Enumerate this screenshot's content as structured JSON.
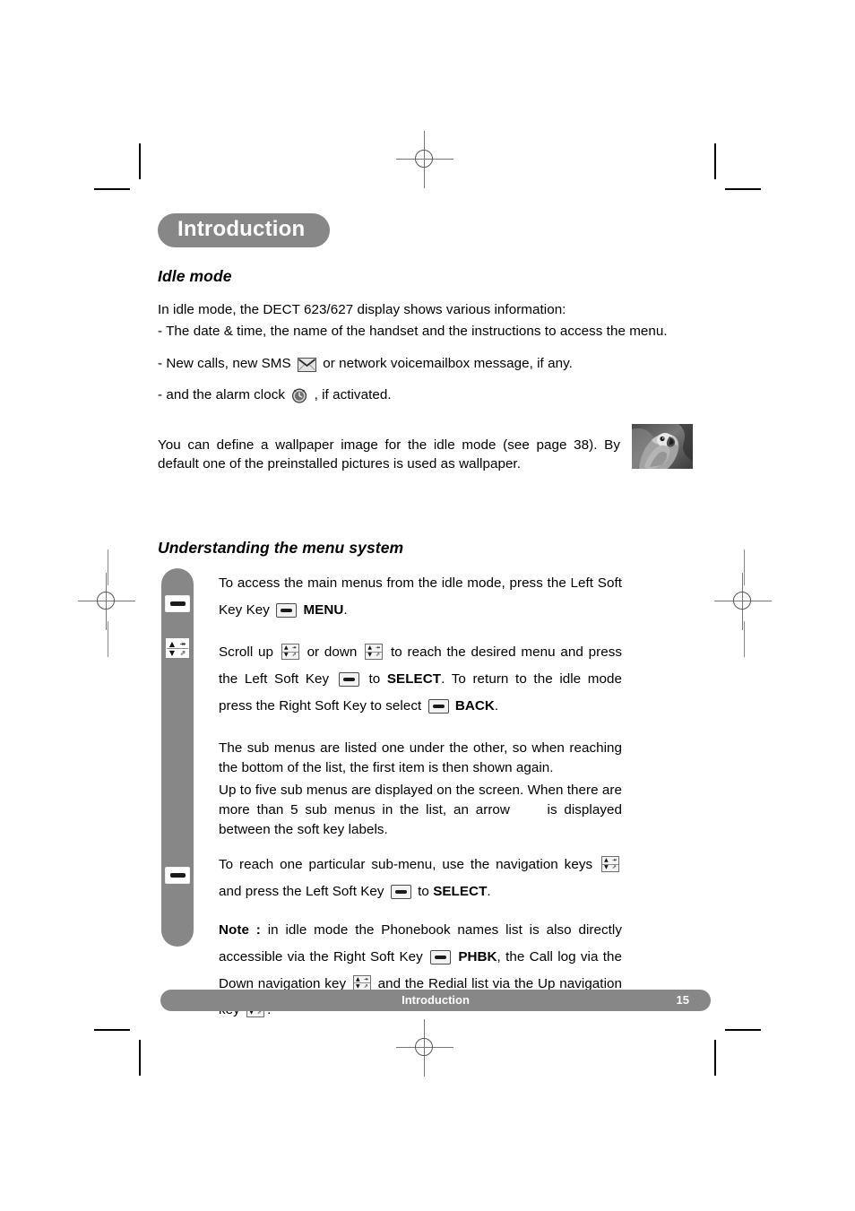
{
  "page": {
    "chapter_title": "Introduction",
    "footer_title": "Introduction",
    "page_number": "15",
    "accent_gray": "#878787"
  },
  "sections": {
    "idle_mode": {
      "heading": "Idle mode",
      "intro": "In idle mode, the DECT 623/627 display shows various information:",
      "bullet_date": "- The date & time, the name of the handset and the instructions to access the menu.",
      "bullet_sms_before": "- New calls, new SMS",
      "bullet_sms_after": "or network voicemailbox message, if any.",
      "bullet_alarm_before": "- and the alarm clock",
      "bullet_alarm_after": ", if activated.",
      "wallpaper_paragraph": "You can define a wallpaper image for the idle mode (see page 38). By default one of the preinstalled pictures is used as wallpaper.",
      "wallpaper_image_alt": "parrot-wallpaper-thumbnail"
    },
    "menu_system": {
      "heading": "Understanding the menu system",
      "p1_a": "To access the main menus from the idle mode, press the Left Soft Key",
      "p1_b": "MENU",
      "p1_c": ".",
      "p2_a": "Scroll up",
      "p2_b": "or down",
      "p2_c": "to reach the desired menu and press the Left Soft Key",
      "p2_d": "to",
      "p2_e": "SELECT",
      "p2_f": ". To return to the idle mode press the Right Soft Key to select",
      "p2_g": "BACK",
      "p2_h": ".",
      "p3": "The sub menus are listed one under the other, so when reaching the bottom of the list, the first item is then shown again.",
      "p4_a": "Up to five sub menus are displayed on the screen. When there are more than 5 sub menus in the list, an arrow",
      "p4_b": "is displayed between the soft key labels.",
      "p5_a": "To reach one particular sub-menu, use the navigation keys",
      "p5_b": "and press the Left Soft Key",
      "p5_c": "to",
      "p5_d": "SELECT",
      "p5_e": ".",
      "note_label": "Note :",
      "note_a": "in idle mode the Phonebook names list is also directly accessible via the Right Soft Key",
      "note_b": "PHBK",
      "note_c": ", the Call log via the Down navigation key",
      "note_d": "and the Redial list via the Up navigation key",
      "note_e": "."
    }
  },
  "icons": {
    "soft_key": "soft-key-icon",
    "nav_key": "navigation-key-icon",
    "envelope": "envelope-sms-icon",
    "alarm_clock": "alarm-clock-icon",
    "nav_up_glyph": "▲",
    "nav_down_glyph": "▼",
    "nav_right_glyph": "↠",
    "nav_extra_glyph": "⇗"
  }
}
